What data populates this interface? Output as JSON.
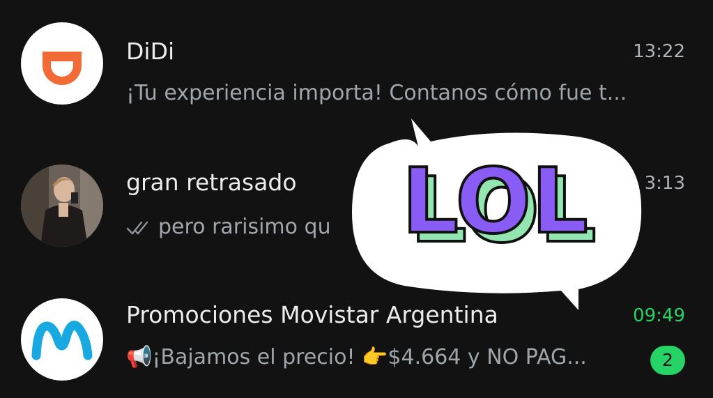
{
  "chats": [
    {
      "name": "DiDi",
      "time": "13:22",
      "preview": "¡Tu experiencia importa!  Contanos cómo fue t...",
      "avatar_icon": "didi-logo-icon",
      "brand_color": "#f26a36"
    },
    {
      "name": "gran retrasado",
      "time": "3:13",
      "preview": "pero rarisimo qu",
      "avatar_icon": "profile-photo",
      "status_icon": "double-check-icon"
    },
    {
      "name": "Promociones Movistar Argentina",
      "time": "09:49",
      "time_color": "#25d366",
      "preview": "📢¡Bajamos el precio! 👉$4.664 y NO PAG...",
      "unread": "2",
      "avatar_icon": "movistar-logo-icon",
      "brand_color": "#19a9e1"
    }
  ],
  "sticker": {
    "text": "LOL",
    "fill_color": "#8a5cf6",
    "shadow_color": "#93e6b0"
  }
}
